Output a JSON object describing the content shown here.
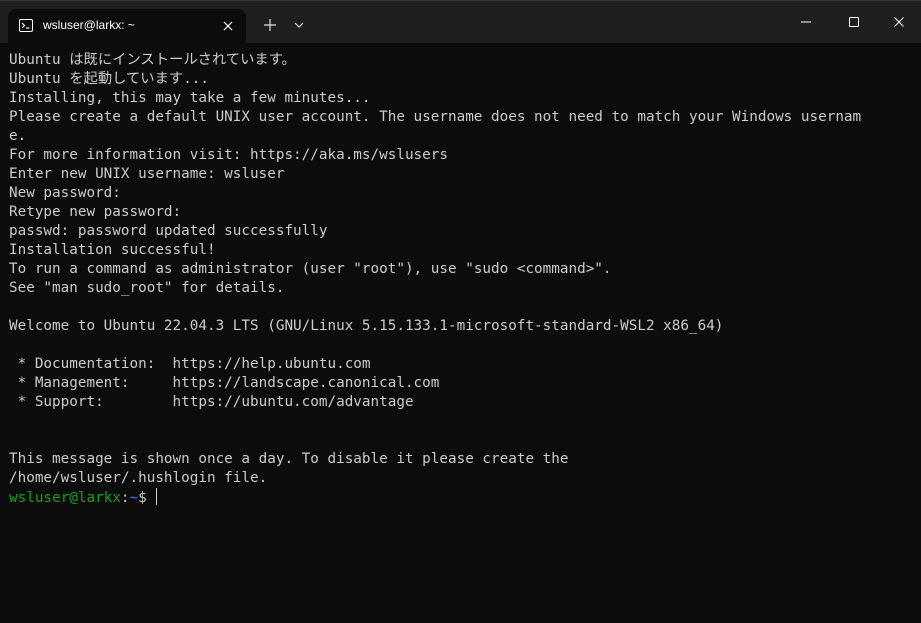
{
  "tab": {
    "title": "wsluser@larkx: ~",
    "icon": "terminal-icon"
  },
  "titlebar": {
    "new_tab_icon": "plus-icon",
    "dropdown_icon": "chevron-down-icon",
    "minimize_icon": "minimize-icon",
    "maximize_icon": "maximize-icon",
    "close_icon": "close-icon"
  },
  "colors": {
    "background": "#0c0c0c",
    "foreground": "#cccccc",
    "titlebar": "#1f1f1f",
    "prompt_user": "#13a10e",
    "prompt_path": "#3b78ff"
  },
  "terminal": {
    "lines": [
      "Ubuntu は既にインストールされています。",
      "Ubuntu を起動しています...",
      "Installing, this may take a few minutes...",
      "Please create a default UNIX user account. The username does not need to match your Windows usernam",
      "e.",
      "For more information visit: https://aka.ms/wslusers",
      "Enter new UNIX username: wsluser",
      "New password:",
      "Retype new password:",
      "passwd: password updated successfully",
      "Installation successful!",
      "To run a command as administrator (user \"root\"), use \"sudo <command>\".",
      "See \"man sudo_root\" for details.",
      "",
      "Welcome to Ubuntu 22.04.3 LTS (GNU/Linux 5.15.133.1-microsoft-standard-WSL2 x86_64)",
      "",
      " * Documentation:  https://help.ubuntu.com",
      " * Management:     https://landscape.canonical.com",
      " * Support:        https://ubuntu.com/advantage",
      "",
      "",
      "This message is shown once a day. To disable it please create the",
      "/home/wsluser/.hushlogin file."
    ],
    "prompt": {
      "user_host": "wsluser@larkx",
      "separator": ":",
      "path": "~",
      "symbol": "$"
    }
  }
}
